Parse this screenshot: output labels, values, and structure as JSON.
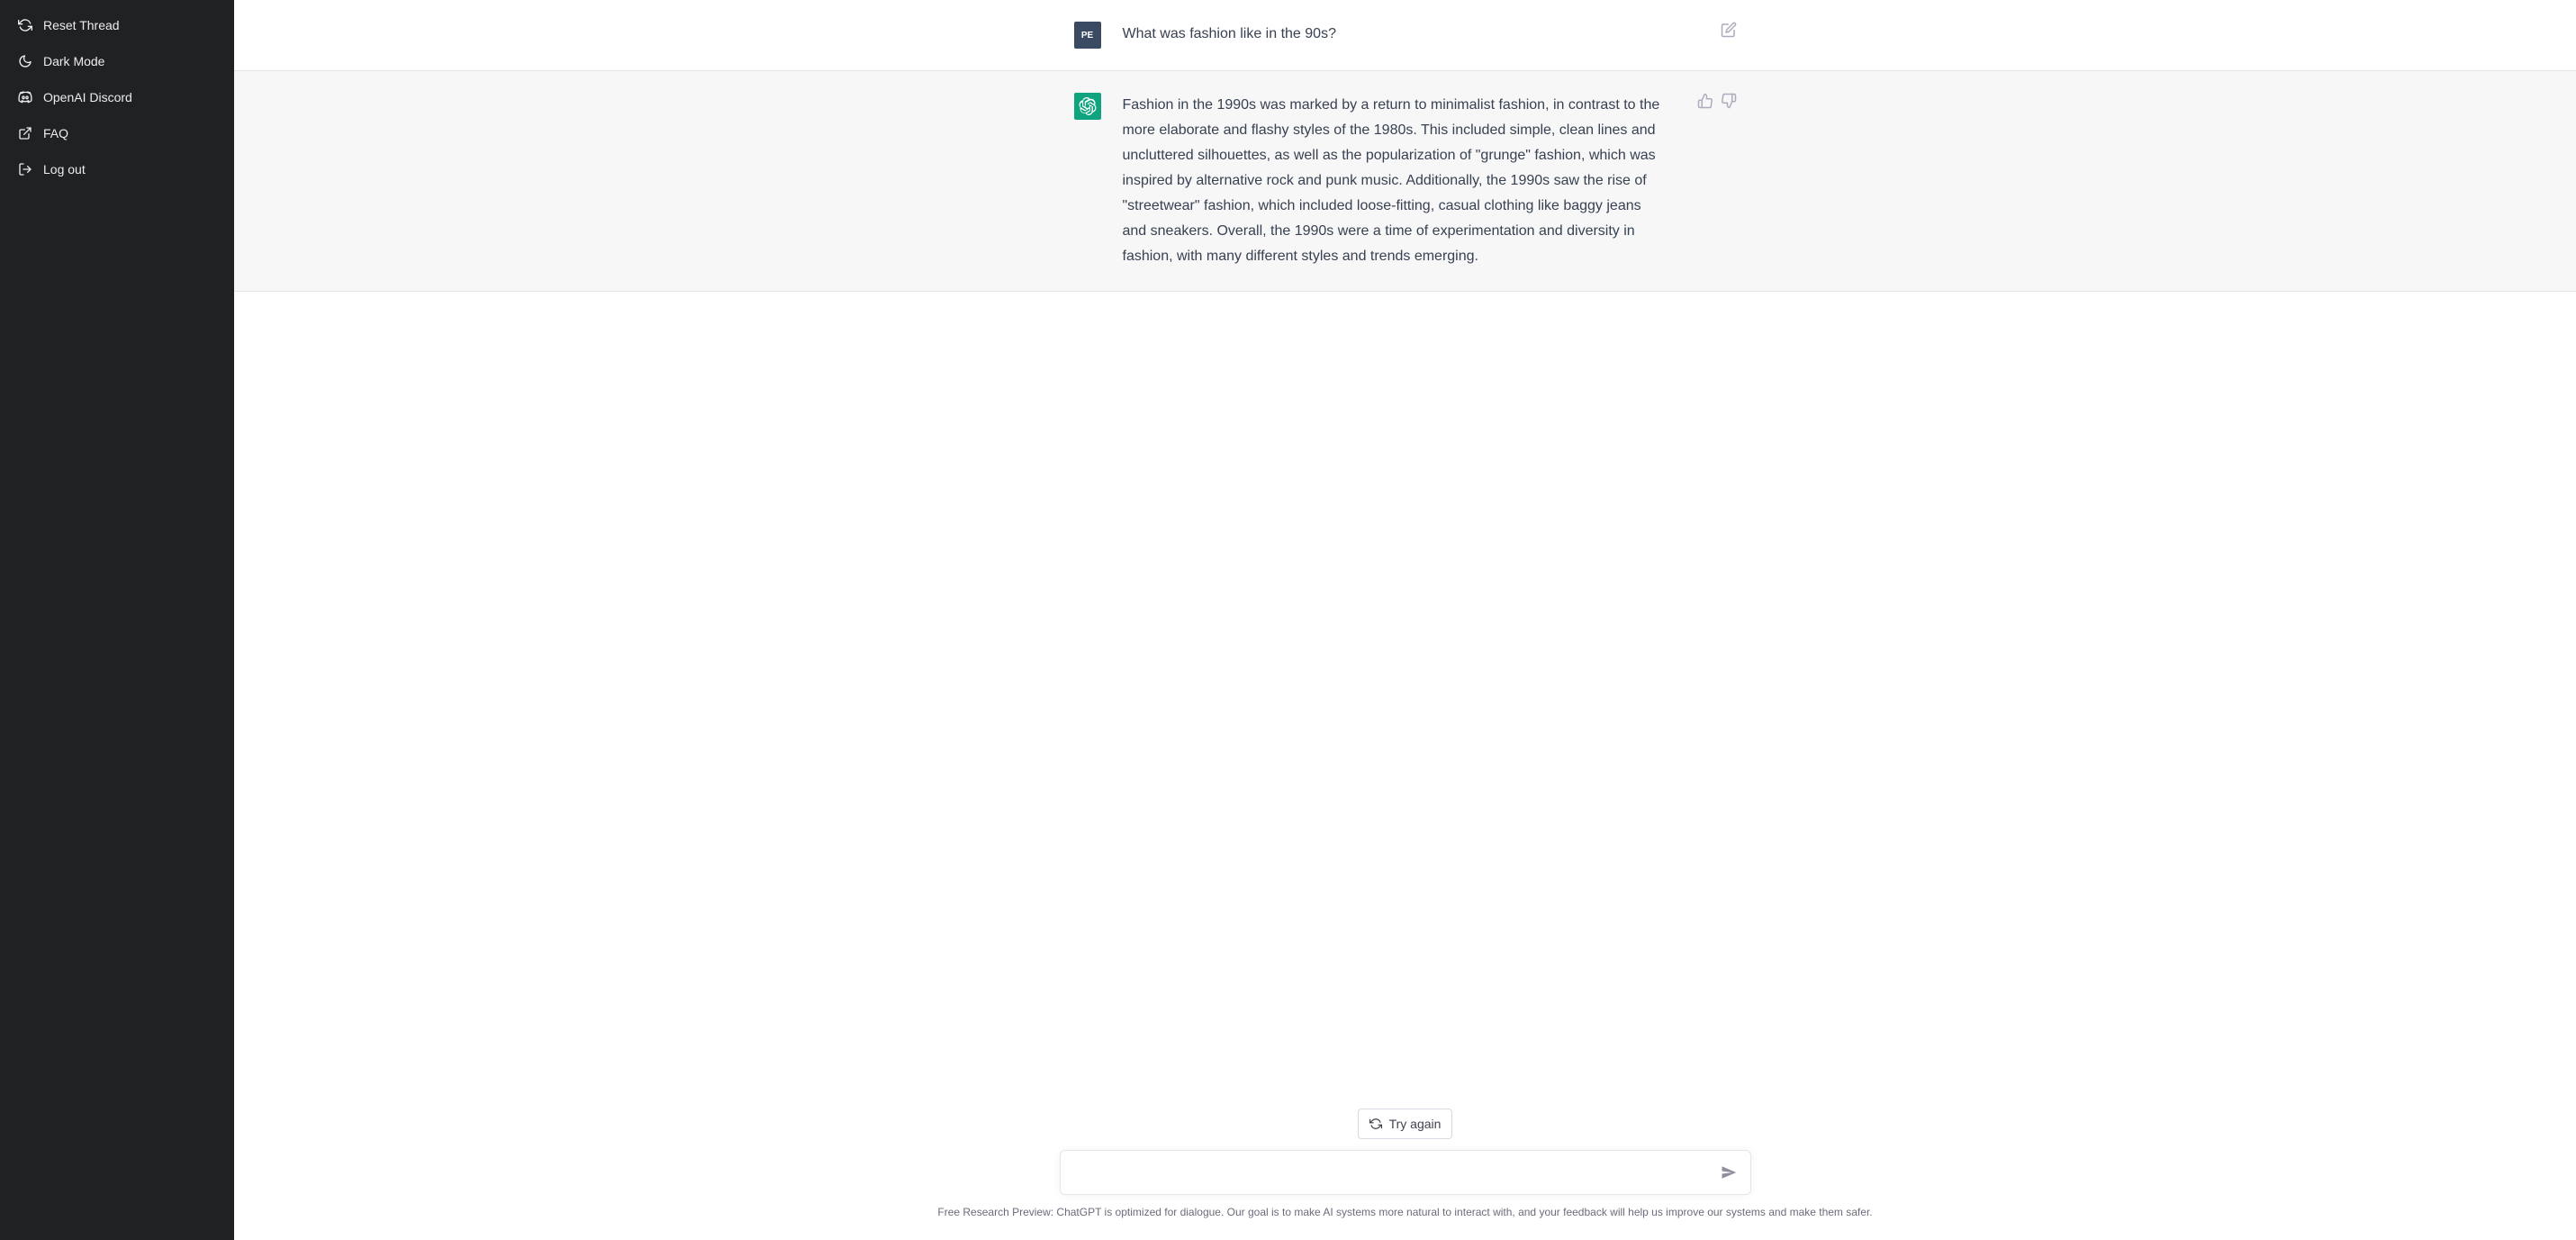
{
  "sidebar": {
    "items": [
      {
        "label": "Reset Thread"
      },
      {
        "label": "Dark Mode"
      },
      {
        "label": "OpenAI Discord"
      },
      {
        "label": "FAQ"
      },
      {
        "label": "Log out"
      }
    ]
  },
  "conversation": {
    "user": {
      "avatar_initials": "PE",
      "text": "What was fashion like in the 90s?"
    },
    "assistant": {
      "text": "Fashion in the 1990s was marked by a return to minimalist fashion, in contrast to the more elaborate and flashy styles of the 1980s. This included simple, clean lines and uncluttered silhouettes, as well as the popularization of \"grunge\" fashion, which was inspired by alternative rock and punk music. Additionally, the 1990s saw the rise of \"streetwear\" fashion, which included loose-fitting, casual clothing like baggy jeans and sneakers. Overall, the 1990s were a time of experimentation and diversity in fashion, with many different styles and trends emerging."
    }
  },
  "controls": {
    "try_again_label": "Try again",
    "input_placeholder": ""
  },
  "footer": {
    "disclaimer": "Free Research Preview: ChatGPT is optimized for dialogue. Our goal is to make AI systems more natural to interact with, and your feedback will help us improve our systems and make them safer."
  }
}
